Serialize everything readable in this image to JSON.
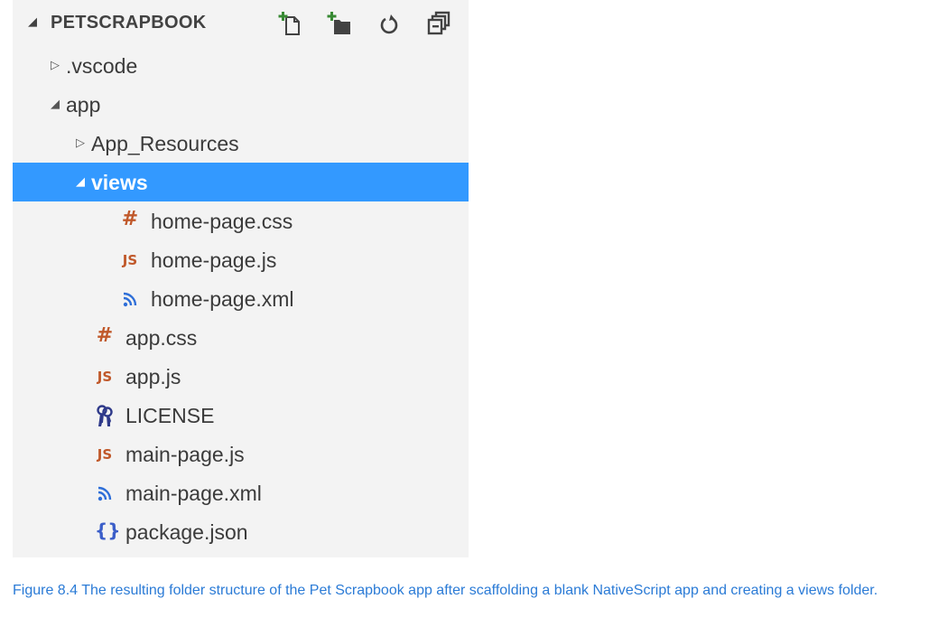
{
  "explorer": {
    "header": {
      "caret": "◢",
      "title": "PETSCRAPBOOK",
      "actions": [
        {
          "name": "new-file-icon"
        },
        {
          "name": "new-folder-icon"
        },
        {
          "name": "refresh-icon"
        },
        {
          "name": "collapse-all-icon"
        }
      ]
    },
    "tree": [
      {
        "label": ".vscode",
        "kind": "folder",
        "expanded": false,
        "caret": "▷",
        "level": 0
      },
      {
        "label": "app",
        "kind": "folder",
        "expanded": true,
        "caret": "◢",
        "level": 0
      },
      {
        "label": "App_Resources",
        "kind": "folder",
        "expanded": false,
        "caret": "▷",
        "level": 1
      },
      {
        "label": "views",
        "kind": "folder",
        "expanded": true,
        "caret": "◢",
        "level": 1,
        "selected": true
      },
      {
        "label": "home-page.css",
        "kind": "css",
        "icon": "#",
        "level": 2
      },
      {
        "label": "home-page.js",
        "kind": "js",
        "icon": "JS",
        "level": 2
      },
      {
        "label": "home-page.xml",
        "kind": "xml",
        "icon": "rss-icon",
        "level": 2
      },
      {
        "label": "app.css",
        "kind": "css",
        "icon": "#",
        "level": 1
      },
      {
        "label": "app.js",
        "kind": "js",
        "icon": "JS",
        "level": 1
      },
      {
        "label": "LICENSE",
        "kind": "license",
        "icon": "keys-icon",
        "level": 1
      },
      {
        "label": "main-page.js",
        "kind": "js",
        "icon": "JS",
        "level": 1
      },
      {
        "label": "main-page.xml",
        "kind": "xml",
        "icon": "rss-icon",
        "level": 1
      },
      {
        "label": "package.json",
        "kind": "json",
        "icon": "{}",
        "level": 1
      }
    ],
    "colors": {
      "selection": "#3399ff",
      "css_js_icon": "#c0582a",
      "xml_icon": "#2f6fd8",
      "json_icon": "#3b5ec9",
      "license_icon": "#2f3a8a"
    }
  },
  "caption": "Figure 8.4 The resulting folder structure of the Pet Scrapbook app after scaffolding a blank NativeScript app and creating a views folder."
}
